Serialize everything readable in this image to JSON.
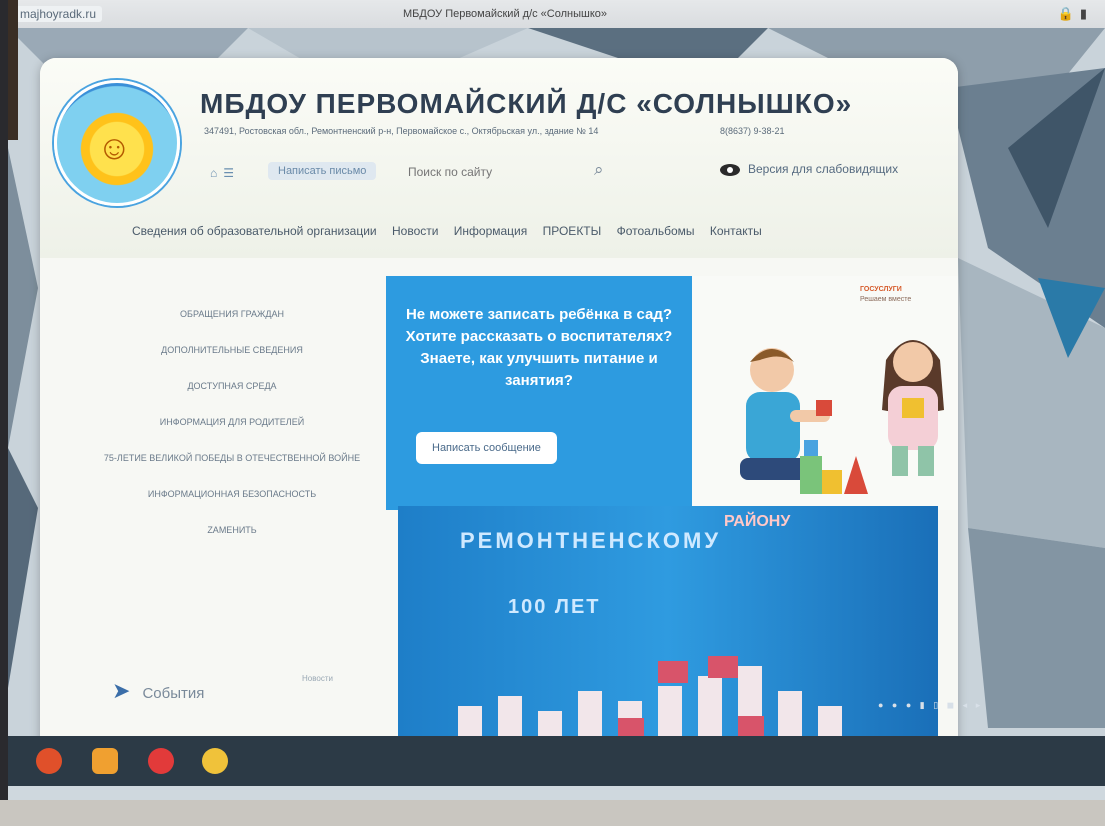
{
  "browser": {
    "url": "majhoyradk.ru",
    "tab_title": "МБДОУ Первомайский д/с «Солнышко»",
    "icons": [
      "lock-icon",
      "bookmark-icon"
    ]
  },
  "header": {
    "logo_alt": "logo",
    "site_title": "МБДОУ ПЕРВОМАЙСКИЙ Д/С «СОЛНЫШКО»",
    "address": "347491, Ростовская обл., Ремонтненский р-н, Первомайское с., Октябрьская ул., здание № 14",
    "phone": "8(8637) 9-38-21",
    "write_letter": "Написать письмо",
    "search_placeholder": "Поиск по сайту",
    "vision_version": "Версия для слабовидящих"
  },
  "nav": {
    "items": [
      "Сведения об образовательной организации",
      "Новости",
      "Информация",
      "ПРОЕКТЫ",
      "Фотоальбомы",
      "Контакты"
    ]
  },
  "sidebar": {
    "items": [
      "Обращения граждан",
      "Дополнительные сведения",
      "Доступная среда",
      "Информация для родителей",
      "75-летие Великой Победы в Отечественной войне",
      "Информационная безопасность",
      "Zаменить"
    ],
    "events_label": "События",
    "events_right": "Новости"
  },
  "banner": {
    "text": "Не можете записать ребёнка в сад? Хотите рассказать о воспитателях? Знаете, как улучшить питание и занятия?",
    "button": "Написать сообщение",
    "illu_label": "ГОСУСЛУГИ",
    "illu_sub": "Решаем вместе"
  },
  "photo": {
    "line1": "РЕМОНТНЕНСКОМУ",
    "line2": "100 ЛЕТ",
    "vertical": "РАЙОНУ"
  },
  "colors": {
    "banner_blue": "#2d9be0",
    "taskbar": "#2c3a46",
    "title": "#2f3f52"
  }
}
